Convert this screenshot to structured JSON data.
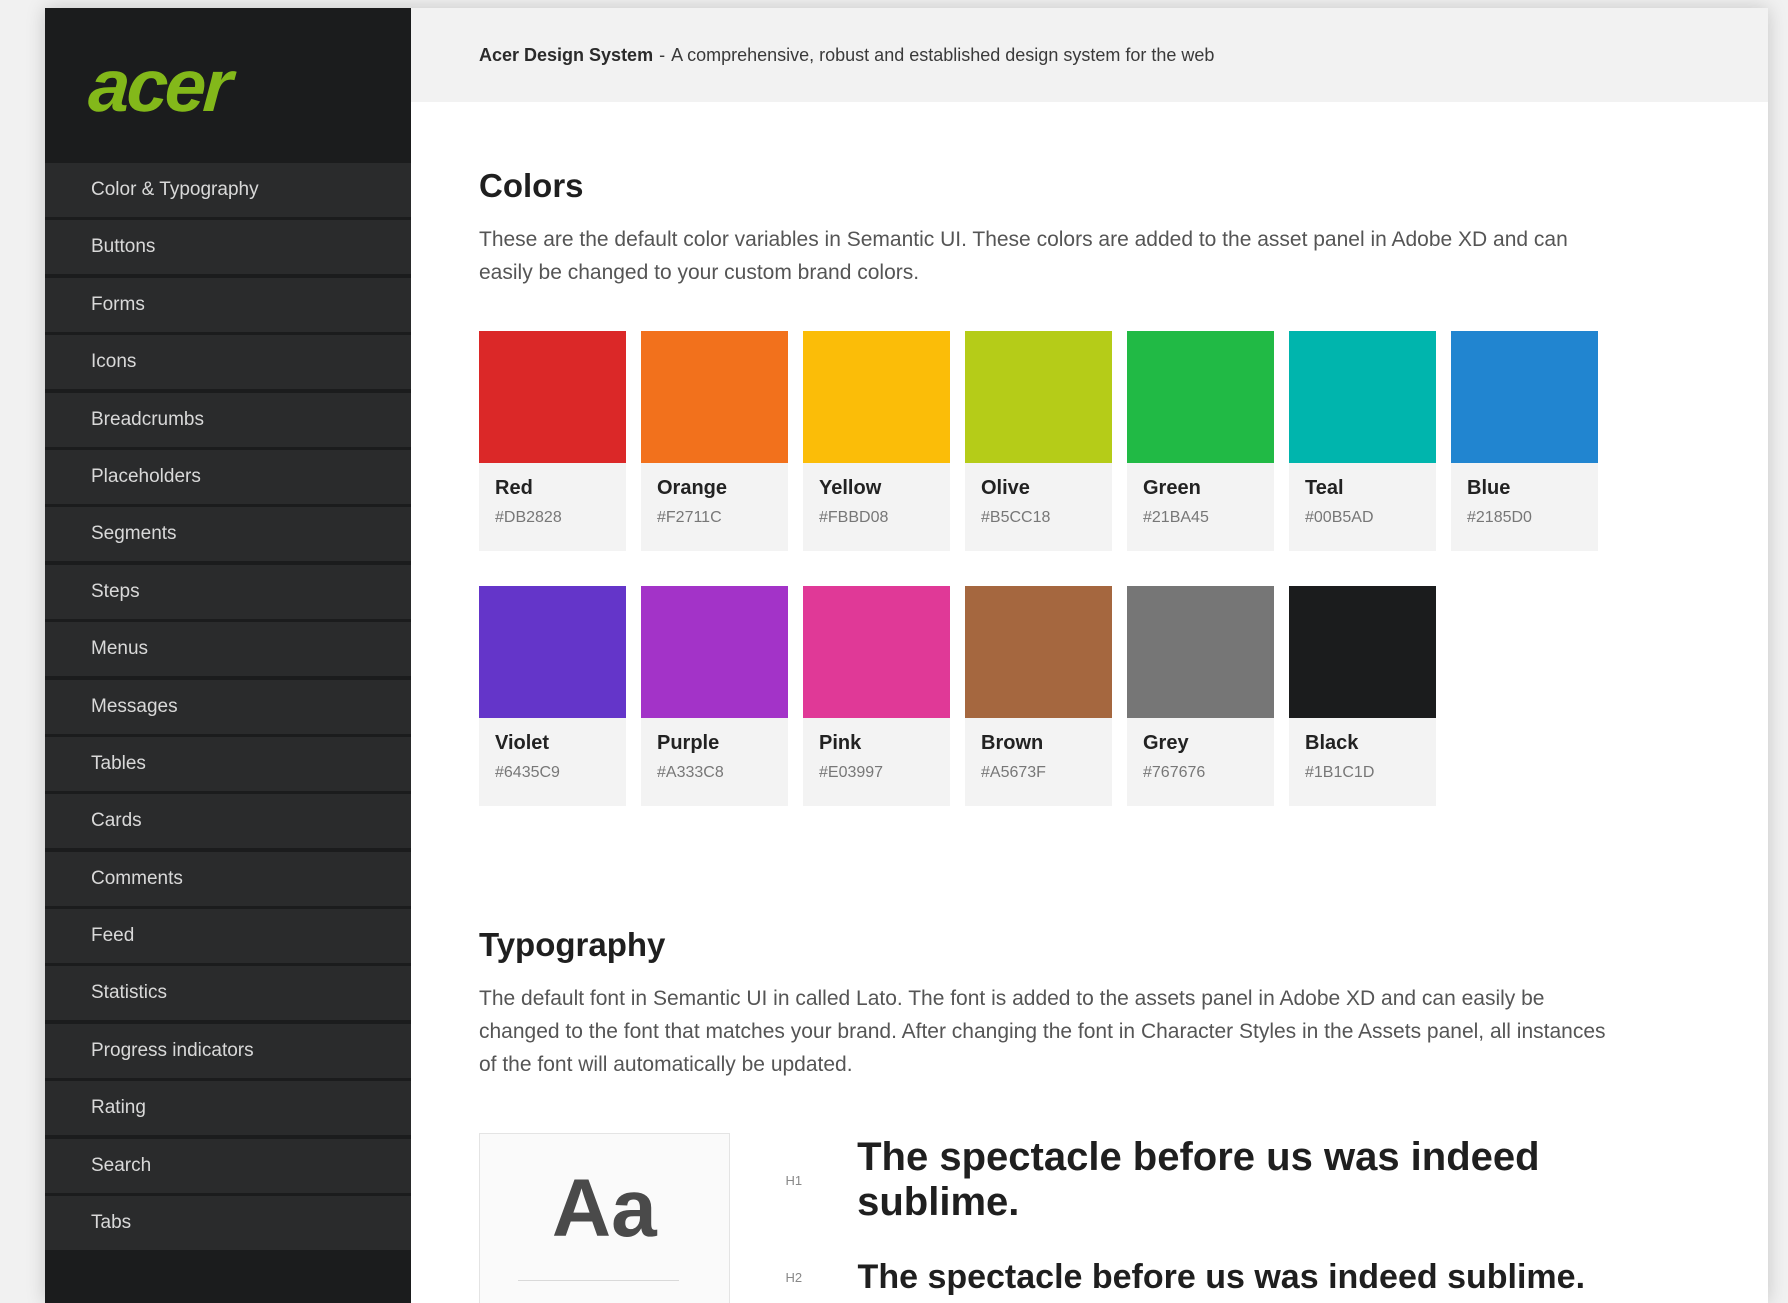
{
  "brand": {
    "logo_text": "acer",
    "logo_color": "#83B81A"
  },
  "sidebar": {
    "items": [
      {
        "label": "Color & Typography"
      },
      {
        "label": "Buttons"
      },
      {
        "label": "Forms"
      },
      {
        "label": "Icons"
      },
      {
        "label": "Breadcrumbs"
      },
      {
        "label": "Placeholders"
      },
      {
        "label": "Segments"
      },
      {
        "label": "Steps"
      },
      {
        "label": "Menus"
      },
      {
        "label": "Messages"
      },
      {
        "label": "Tables"
      },
      {
        "label": "Cards"
      },
      {
        "label": "Comments"
      },
      {
        "label": "Feed"
      },
      {
        "label": "Statistics"
      },
      {
        "label": "Progress indicators"
      },
      {
        "label": "Rating"
      },
      {
        "label": "Search"
      },
      {
        "label": "Tabs"
      }
    ]
  },
  "header": {
    "title": "Acer Design System",
    "separator": "-",
    "subtitle": "A comprehensive, robust and established design system for the web"
  },
  "colors_section": {
    "title": "Colors",
    "description": "These are the default color variables in Semantic UI. These colors are added to the asset panel in Adobe XD and can easily be changed to your custom brand colors.",
    "swatches": [
      {
        "name": "Red",
        "hex": "#DB2828",
        "color": "#DB2828"
      },
      {
        "name": "Orange",
        "hex": "#F2711C",
        "color": "#F2711C"
      },
      {
        "name": "Yellow",
        "hex": "#FBBD08",
        "color": "#FBBD08"
      },
      {
        "name": "Olive",
        "hex": "#B5CC18",
        "color": "#B5CC18"
      },
      {
        "name": "Green",
        "hex": "#21BA45",
        "color": "#21BA45"
      },
      {
        "name": "Teal",
        "hex": "#00B5AD",
        "color": "#00B5AD"
      },
      {
        "name": "Blue",
        "hex": "#2185D0",
        "color": "#2185D0"
      },
      {
        "name": "Violet",
        "hex": "#6435C9",
        "color": "#6435C9"
      },
      {
        "name": "Purple",
        "hex": "#A333C8",
        "color": "#A333C8"
      },
      {
        "name": "Pink",
        "hex": "#E03997",
        "color": "#E03997"
      },
      {
        "name": "Brown",
        "hex": "#A5673F",
        "color": "#A5673F"
      },
      {
        "name": "Grey",
        "hex": "#767676",
        "color": "#767676"
      },
      {
        "name": "Black",
        "hex": "#1B1C1D",
        "color": "#1B1C1D"
      }
    ]
  },
  "typography_section": {
    "title": "Typography",
    "description": "The default font in Semantic UI in called Lato. The font is added to the assets panel in Adobe XD and can easily be changed to the font that matches your brand. After changing the font in Character Styles in the Assets panel, all instances of the font will automatically be updated.",
    "preview_glyph": "Aa",
    "samples": [
      {
        "tag": "H1",
        "text": "The spectacle before us was indeed sublime."
      },
      {
        "tag": "H2",
        "text": "The spectacle before us was indeed sublime."
      }
    ]
  }
}
